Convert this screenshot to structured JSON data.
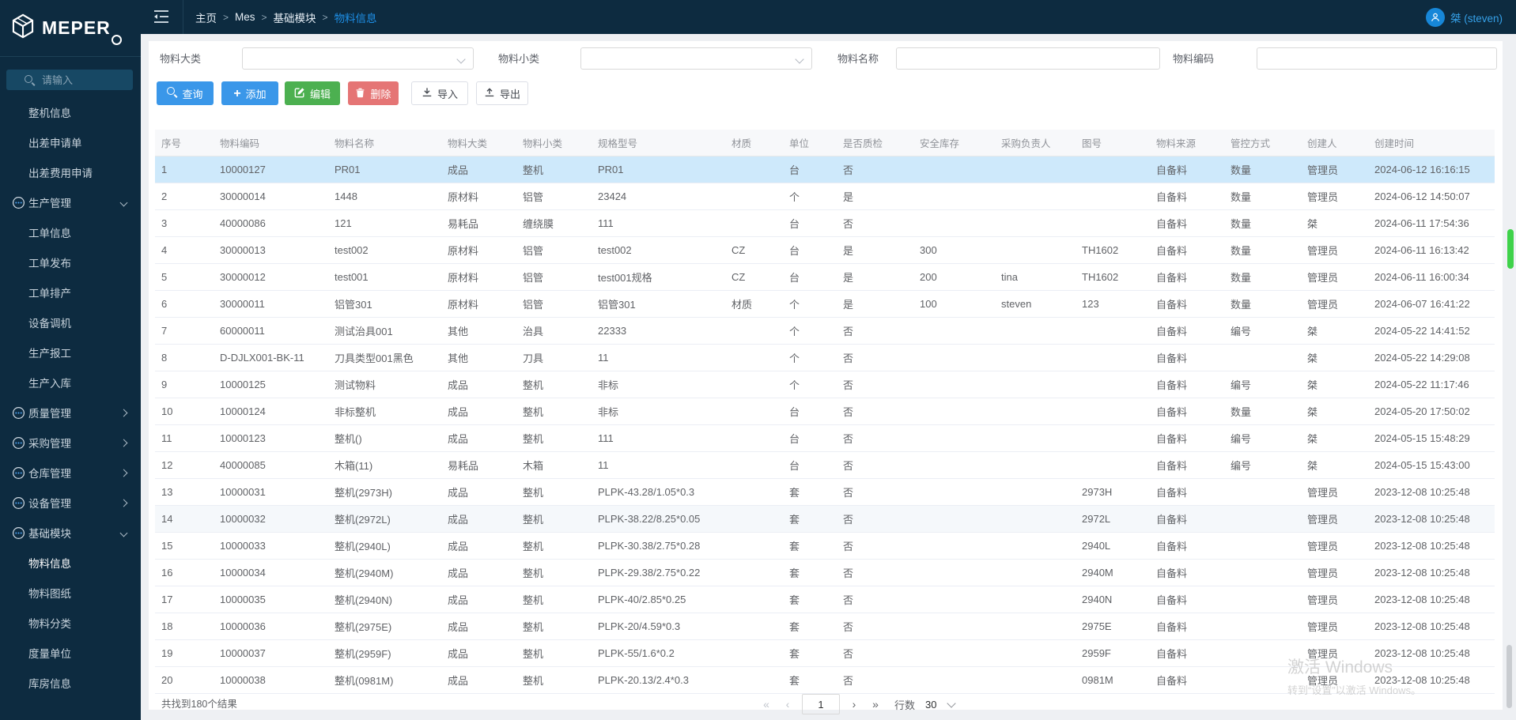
{
  "topbar": {
    "logo_text": "MEPER",
    "breadcrumb": [
      "主页",
      "Mes",
      "基础模块",
      "物料信息"
    ],
    "breadcrumb_active": "物料信息",
    "user_name": "桀 (steven)"
  },
  "sidebar": {
    "search_placeholder": "请输入",
    "items": [
      {
        "label": "整机信息",
        "type": "item"
      },
      {
        "label": "出差申请单",
        "type": "item"
      },
      {
        "label": "出差费用申请",
        "type": "item"
      },
      {
        "label": "生产管理",
        "type": "group",
        "chevron": "down"
      },
      {
        "label": "工单信息",
        "type": "item"
      },
      {
        "label": "工单发布",
        "type": "item"
      },
      {
        "label": "工单排产",
        "type": "item"
      },
      {
        "label": "设备调机",
        "type": "item"
      },
      {
        "label": "生产报工",
        "type": "item"
      },
      {
        "label": "生产入库",
        "type": "item"
      },
      {
        "label": "质量管理",
        "type": "group",
        "chevron": "right"
      },
      {
        "label": "采购管理",
        "type": "group",
        "chevron": "right"
      },
      {
        "label": "仓库管理",
        "type": "group",
        "chevron": "right"
      },
      {
        "label": "设备管理",
        "type": "group",
        "chevron": "right"
      },
      {
        "label": "基础模块",
        "type": "group",
        "chevron": "down"
      },
      {
        "label": "物料信息",
        "type": "item",
        "active": true
      },
      {
        "label": "物料图纸",
        "type": "item"
      },
      {
        "label": "物料分类",
        "type": "item"
      },
      {
        "label": "度量单位",
        "type": "item"
      },
      {
        "label": "库房信息",
        "type": "item"
      }
    ]
  },
  "filters": {
    "fields": [
      {
        "label": "物料大类",
        "kind": "select",
        "value": ""
      },
      {
        "label": "物料小类",
        "kind": "select",
        "value": ""
      },
      {
        "label": "物料名称",
        "kind": "input",
        "value": ""
      },
      {
        "label": "物料编码",
        "kind": "input",
        "value": ""
      }
    ]
  },
  "toolbar": {
    "buttons": [
      {
        "label": "查询",
        "icon": "search-icon",
        "style": "blue"
      },
      {
        "label": "添加",
        "icon": "plus-icon",
        "style": "blue"
      },
      {
        "label": "编辑",
        "icon": "edit-icon",
        "style": "green"
      },
      {
        "label": "删除",
        "icon": "trash-icon",
        "style": "red"
      },
      {
        "label": "导入",
        "icon": "import-icon",
        "style": "plain"
      },
      {
        "label": "导出",
        "icon": "export-icon",
        "style": "plain"
      }
    ]
  },
  "table": {
    "columns": [
      "序号",
      "物料编码",
      "物料名称",
      "物料大类",
      "物料小类",
      "规格型号",
      "材质",
      "单位",
      "是否质检",
      "安全库存",
      "采购负责人",
      "图号",
      "物料来源",
      "管控方式",
      "创建人",
      "创建时间"
    ],
    "selected_row_index": 0,
    "hovered_row_index": 13,
    "rows": [
      [
        "1",
        "10000127",
        "PR01",
        "成品",
        "整机",
        "PR01",
        "",
        "台",
        "否",
        "",
        "",
        "",
        "自备料",
        "数量",
        "管理员",
        "2024-06-12 16:16:15"
      ],
      [
        "2",
        "30000014",
        "1448",
        "原材料",
        "铝管",
        "23424",
        "",
        "个",
        "是",
        "",
        "",
        "",
        "自备料",
        "数量",
        "管理员",
        "2024-06-12 14:50:07"
      ],
      [
        "3",
        "40000086",
        "121",
        "易耗品",
        "缠绕膜",
        "111",
        "",
        "台",
        "否",
        "",
        "",
        "",
        "自备料",
        "数量",
        "桀",
        "2024-06-11 17:54:36"
      ],
      [
        "4",
        "30000013",
        "test002",
        "原材料",
        "铝管",
        "test002",
        "CZ",
        "台",
        "是",
        "300",
        "",
        "TH1602",
        "自备料",
        "数量",
        "管理员",
        "2024-06-11 16:13:42"
      ],
      [
        "5",
        "30000012",
        "test001",
        "原材料",
        "铝管",
        "test001规格",
        "CZ",
        "台",
        "是",
        "200",
        "tina",
        "TH1602",
        "自备料",
        "数量",
        "管理员",
        "2024-06-11 16:00:34"
      ],
      [
        "6",
        "30000011",
        "铝管301",
        "原材料",
        "铝管",
        "铝管301",
        "材质",
        "个",
        "是",
        "100",
        "steven",
        "123",
        "自备料",
        "数量",
        "管理员",
        "2024-06-07 16:41:22"
      ],
      [
        "7",
        "60000011",
        "测试治具001",
        "其他",
        "治具",
        "22333",
        "",
        "个",
        "否",
        "",
        "",
        "",
        "自备料",
        "编号",
        "桀",
        "2024-05-22 14:41:52"
      ],
      [
        "8",
        "D-DJLX001-BK-11",
        "刀具类型001黑色",
        "其他",
        "刀具",
        "11",
        "",
        "个",
        "否",
        "",
        "",
        "",
        "自备料",
        "",
        "桀",
        "2024-05-22 14:29:08"
      ],
      [
        "9",
        "10000125",
        "测试物料",
        "成品",
        "整机",
        "非标",
        "",
        "个",
        "否",
        "",
        "",
        "",
        "自备料",
        "编号",
        "桀",
        "2024-05-22 11:17:46"
      ],
      [
        "10",
        "10000124",
        "非标整机",
        "成品",
        "整机",
        "非标",
        "",
        "台",
        "否",
        "",
        "",
        "",
        "自备料",
        "数量",
        "桀",
        "2024-05-20 17:50:02"
      ],
      [
        "11",
        "10000123",
        "整机()",
        "成品",
        "整机",
        "111",
        "",
        "台",
        "否",
        "",
        "",
        "",
        "自备料",
        "编号",
        "桀",
        "2024-05-15 15:48:29"
      ],
      [
        "12",
        "40000085",
        "木箱(11)",
        "易耗品",
        "木箱",
        "11",
        "",
        "台",
        "否",
        "",
        "",
        "",
        "自备料",
        "编号",
        "桀",
        "2024-05-15 15:43:00"
      ],
      [
        "13",
        "10000031",
        "整机(2973H)",
        "成品",
        "整机",
        "PLPK-43.28/1.05*0.3",
        "",
        "套",
        "否",
        "",
        "",
        "2973H",
        "自备料",
        "",
        "管理员",
        "2023-12-08 10:25:48"
      ],
      [
        "14",
        "10000032",
        "整机(2972L)",
        "成品",
        "整机",
        "PLPK-38.22/8.25*0.05",
        "",
        "套",
        "否",
        "",
        "",
        "2972L",
        "自备料",
        "",
        "管理员",
        "2023-12-08 10:25:48"
      ],
      [
        "15",
        "10000033",
        "整机(2940L)",
        "成品",
        "整机",
        "PLPK-30.38/2.75*0.28",
        "",
        "套",
        "否",
        "",
        "",
        "2940L",
        "自备料",
        "",
        "管理员",
        "2023-12-08 10:25:48"
      ],
      [
        "16",
        "10000034",
        "整机(2940M)",
        "成品",
        "整机",
        "PLPK-29.38/2.75*0.22",
        "",
        "套",
        "否",
        "",
        "",
        "2940M",
        "自备料",
        "",
        "管理员",
        "2023-12-08 10:25:48"
      ],
      [
        "17",
        "10000035",
        "整机(2940N)",
        "成品",
        "整机",
        "PLPK-40/2.85*0.25",
        "",
        "套",
        "否",
        "",
        "",
        "2940N",
        "自备料",
        "",
        "管理员",
        "2023-12-08 10:25:48"
      ],
      [
        "18",
        "10000036",
        "整机(2975E)",
        "成品",
        "整机",
        "PLPK-20/4.59*0.3",
        "",
        "套",
        "否",
        "",
        "",
        "2975E",
        "自备料",
        "",
        "管理员",
        "2023-12-08 10:25:48"
      ],
      [
        "19",
        "10000037",
        "整机(2959F)",
        "成品",
        "整机",
        "PLPK-55/1.6*0.2",
        "",
        "套",
        "否",
        "",
        "",
        "2959F",
        "自备料",
        "",
        "管理员",
        "2023-12-08 10:25:48"
      ],
      [
        "20",
        "10000038",
        "整机(0981M)",
        "成品",
        "整机",
        "PLPK-20.13/2.4*0.3",
        "",
        "套",
        "否",
        "",
        "",
        "0981M",
        "自备料",
        "",
        "管理员",
        "2023-12-08 10:25:48"
      ]
    ]
  },
  "footer": {
    "results_text": "共找到180个结果",
    "pagination": {
      "first": "«",
      "prev": "‹",
      "page": "1",
      "next": "›",
      "last": "»",
      "rows_label": "行数",
      "rows_value": "30"
    }
  },
  "watermark": {
    "line1": "激活 Windows",
    "line2": "转到“设置”以激活 Windows。"
  },
  "colors": {
    "topbar": "#0d2b40",
    "sidebar": "#0d2b40",
    "accent_blue": "#1e90e8",
    "button_blue": "#3a97e9",
    "button_green": "#4cb050",
    "button_red": "#e57575",
    "selected_row": "#cee9fb",
    "scroll_green": "#3fd24a"
  }
}
